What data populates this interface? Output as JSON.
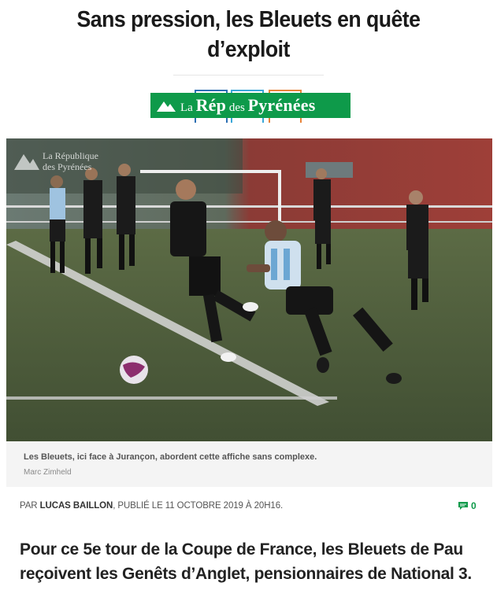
{
  "article": {
    "title": "Sans pression, les Bleuets en quête d’exploit",
    "caption": "Les Bleuets, ici face à Jurançon, abordent cette affiche sans complexe.",
    "photo_credit": "Marc Zimheld",
    "byline_prefix": "Par",
    "author": "Lucas Baillon",
    "published": ", publié le 11 octobre 2019 à 20h16.",
    "comment_count": "0",
    "chapo": "Pour ce 5e tour de la Coupe de France, les Bleuets de Pau reçoivent les Genêts d’Anglet, pensionnaires de National 3."
  },
  "logo": {
    "la": "La",
    "rep": "Rép",
    "des": "des",
    "pyrenees": "Pyrénées",
    "watermark_line1": "La République",
    "watermark_line2": "des Pyrénées"
  },
  "colors": {
    "brand_green": "#0e9a4a",
    "bracket_1": "#2d6fb3",
    "bracket_2": "#3aa7d8",
    "bracket_3": "#e8833a"
  },
  "icons": {
    "logo_mountain": "mountain-icon",
    "comments": "speech-bubble-icon"
  }
}
